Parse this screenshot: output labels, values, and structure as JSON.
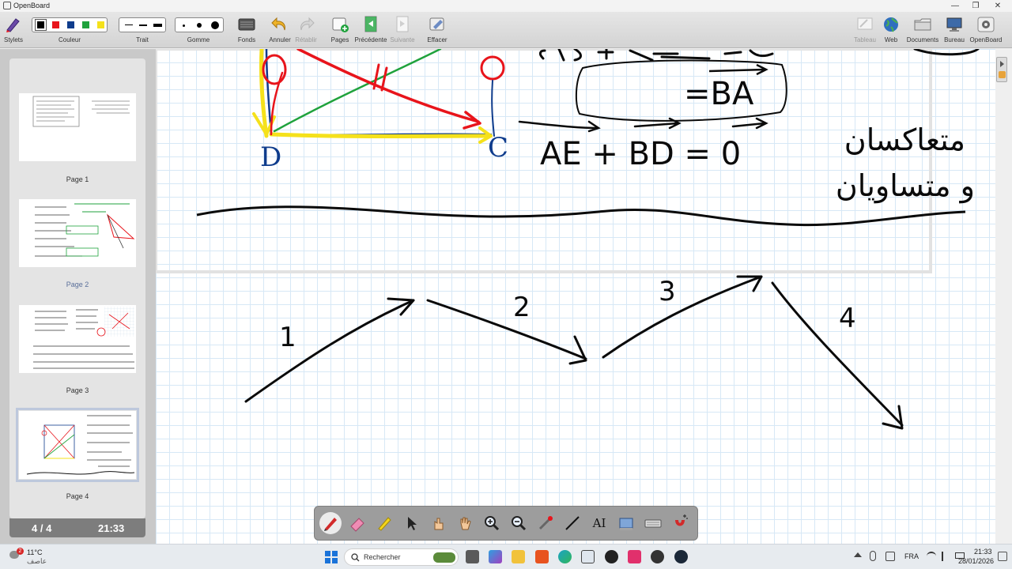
{
  "window": {
    "title": "OpenBoard",
    "minimize": "—",
    "maximize": "❐",
    "close": "✕"
  },
  "toolbar": {
    "stylets": "Stylets",
    "couleur": "Couleur",
    "trait": "Trait",
    "gomme": "Gomme",
    "fonds": "Fonds",
    "annuler": "Annuler",
    "retablir": "Rétablir",
    "pages": "Pages",
    "precedente": "Précédente",
    "suivante": "Suivante",
    "effacer": "Effacer",
    "tableau": "Tableau",
    "web": "Web",
    "documents": "Documents",
    "bureau": "Bureau",
    "openboard": "OpenBoard",
    "colors": [
      "#000000",
      "#e8141b",
      "#0f3c8c",
      "#1fa23c",
      "#f5e11b"
    ]
  },
  "sidebar": {
    "pages": [
      {
        "label": "Page 1",
        "active": false
      },
      {
        "label": "Page 2",
        "active": true
      },
      {
        "label": "Page 3",
        "active": false
      },
      {
        "label": "Page 4",
        "active": false,
        "selected": true
      }
    ],
    "counter": "4 / 4",
    "clock": "21:33"
  },
  "board": {
    "text_C": "C",
    "text_D": "D",
    "text_BA": "=BA",
    "text_equation": "AE + BD = 0",
    "text_arabic_1": "متعاكسان",
    "text_arabic_2": "و متساويان",
    "num_1": "1",
    "num_2": "2",
    "num_3": "3",
    "num_4": "4",
    "ink_colors": {
      "black": "#0a0a0a",
      "red": "#e8141b",
      "green": "#1fa23c",
      "yellow": "#f5e11b",
      "blue": "#0f3c8c"
    }
  },
  "palette": {
    "tools": [
      "pen-icon",
      "eraser-icon",
      "marker-icon",
      "selector-icon",
      "interact-icon",
      "hand-icon",
      "zoom-in-icon",
      "zoom-out-icon",
      "laser-pointer-icon",
      "line-icon",
      "text-icon",
      "capture-icon",
      "keyboard-icon",
      "magnet-icon"
    ],
    "text_tool": "AI"
  },
  "taskbar": {
    "temperature": "11°C",
    "weather": "عاصف",
    "notification_count": "2",
    "search_placeholder": "Rechercher",
    "language": "FRA",
    "time": "21:33",
    "date": "28/01/2026"
  }
}
